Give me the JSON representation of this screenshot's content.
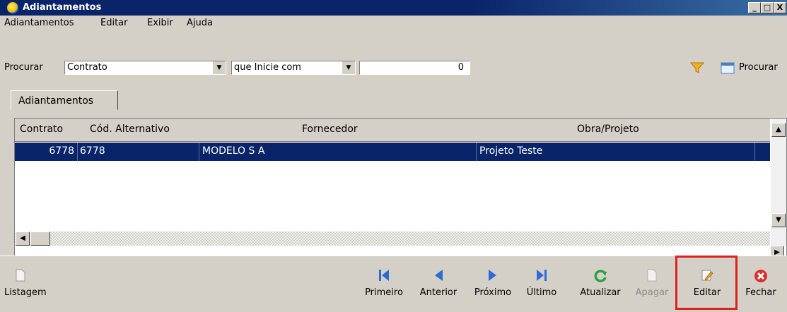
{
  "window": {
    "title": "Adiantamentos",
    "controls": [
      "_",
      "□",
      "X"
    ]
  },
  "menu": [
    "Adiantamentos",
    "Editar",
    "Exibir",
    "Ajuda"
  ],
  "search": {
    "label": "Procurar",
    "field": "Contrato",
    "mode": "que Inicie com",
    "value": "0",
    "search_button": "Procurar"
  },
  "tab": {
    "label": "Adiantamentos"
  },
  "grid": {
    "columns": [
      "Contrato",
      "Cód. Alternativo",
      "Fornecedor",
      "Obra/Projeto"
    ],
    "rows": [
      {
        "contrato": "6778",
        "cod_alternativo": "6778",
        "fornecedor": "MODELO S A",
        "obra_projeto": "Projeto Teste"
      }
    ]
  },
  "toolbar": {
    "listagem": "Listagem",
    "primeiro": "Primeiro",
    "anterior": "Anterior",
    "proximo": "Próximo",
    "ultimo": "Último",
    "atualizar": "Atualizar",
    "apagar": "Apagar",
    "editar": "Editar",
    "fechar": "Fechar"
  },
  "colors": {
    "title_bar": "#0a246a",
    "selection": "#0a246a",
    "highlight_box": "#e02020",
    "nav_icons": "#2c6bd1",
    "refresh_icon": "#2ea043",
    "close_icon": "#d9302c"
  }
}
